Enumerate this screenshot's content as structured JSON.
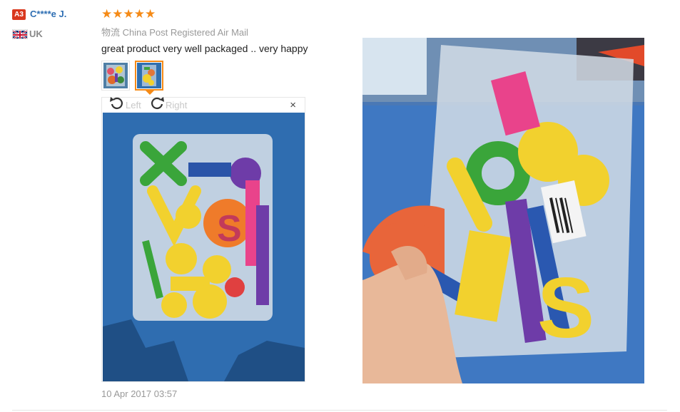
{
  "review": {
    "badge": "A3",
    "username": "C****e J.",
    "country": "UK",
    "stars": "★★★★★",
    "rating": 5,
    "shipping": "物流 China Post Registered Air Mail",
    "comment": "great product very well packaged .. very happy",
    "date": "10 Apr 2017 03:57"
  },
  "viewer": {
    "rotate_left_label": "Left",
    "rotate_right_label": "Right",
    "close_symbol": "×"
  },
  "icons": {
    "flag": "uk-flag-icon",
    "rotate_left": "rotate-left-icon",
    "rotate_right": "rotate-right-icon",
    "close": "close-icon"
  },
  "colors": {
    "accent": "#f58a16",
    "username": "#2f6fb3",
    "badge": "#d9381e",
    "muted": "#999999"
  }
}
